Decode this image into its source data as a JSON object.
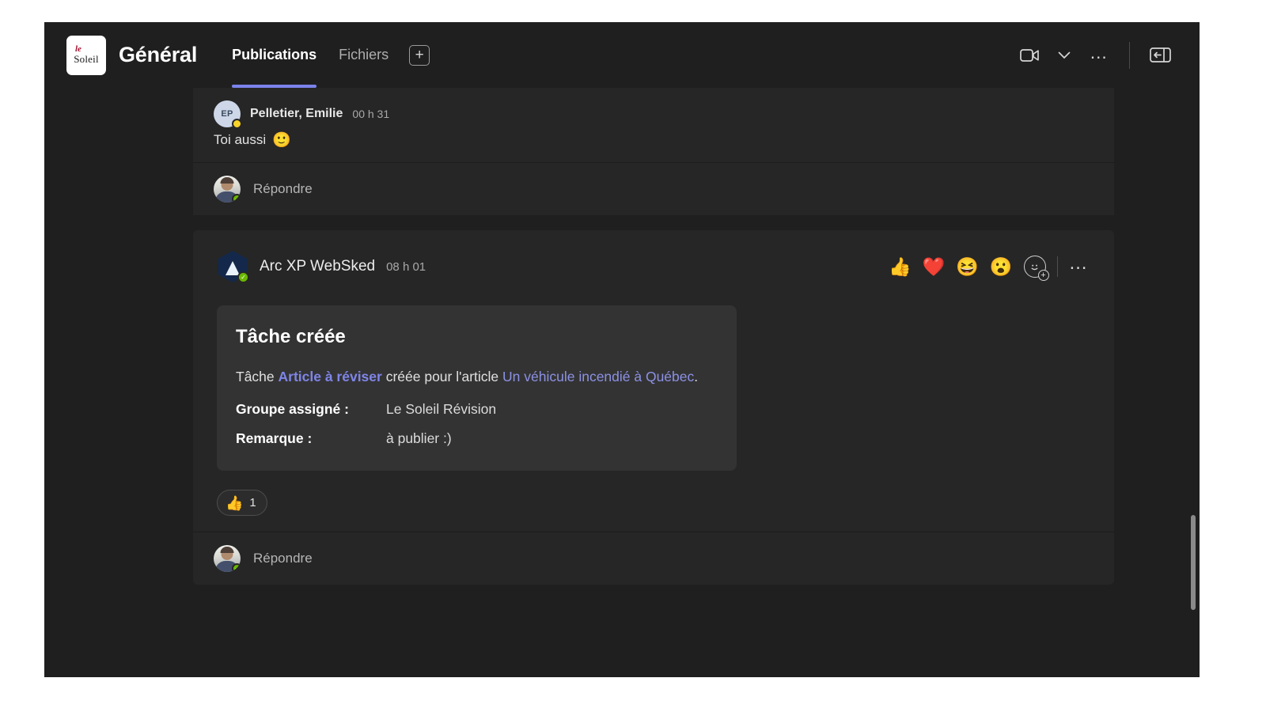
{
  "header": {
    "team_logo_top": "le",
    "team_logo_bottom": "Soleil",
    "channel_title": "Général",
    "tabs": [
      {
        "label": "Publications",
        "active": true
      },
      {
        "label": "Fichiers",
        "active": false
      }
    ],
    "add_tab_label": "+",
    "actions": {
      "meet_now_icon": "video-camera-icon",
      "meet_now_caret": "chevron-down-icon",
      "more_options": "…",
      "open_panel_icon": "panel-toggle-icon"
    }
  },
  "messages": [
    {
      "author": "Pelletier, Emilie",
      "initials": "EP",
      "timestamp": "00 h 31",
      "presence": "away",
      "text": "Toi aussi",
      "emoji": "🙂"
    }
  ],
  "reply_bars": [
    {
      "label": "Répondre",
      "presence": "available"
    },
    {
      "label": "Répondre",
      "presence": "available"
    }
  ],
  "bot_post": {
    "author": "Arc XP WebSked",
    "timestamp": "08 h 01",
    "presence": "available",
    "reactions_toolbar": [
      {
        "name": "thumbs-up",
        "glyph": "👍"
      },
      {
        "name": "heart",
        "glyph": "❤️"
      },
      {
        "name": "laugh",
        "glyph": "😆"
      },
      {
        "name": "surprised",
        "glyph": "😮"
      }
    ],
    "add_reaction_plus": "+",
    "more_options": "…",
    "card": {
      "title": "Tâche créée",
      "body_prefix": "Tâche ",
      "body_task_name": "Article à réviser",
      "body_middle": " créée pour l'article ",
      "body_article_link": "Un véhicule incendié à Québec",
      "body_suffix": ".",
      "fields": [
        {
          "key": "Groupe assigné :",
          "value": "Le Soleil Révision"
        },
        {
          "key": "Remarque :",
          "value": "à publier :)"
        }
      ]
    },
    "reaction_pill": {
      "glyph": "👍",
      "count": "1"
    }
  },
  "colors": {
    "accent": "#7b83eb",
    "link": "#8c91e4",
    "page_bg": "#1f1f1f",
    "message_bg": "#262626",
    "card_bg": "#333333",
    "available": "#6bb700",
    "away": "#f8d22a",
    "brand_red": "#a31431"
  }
}
